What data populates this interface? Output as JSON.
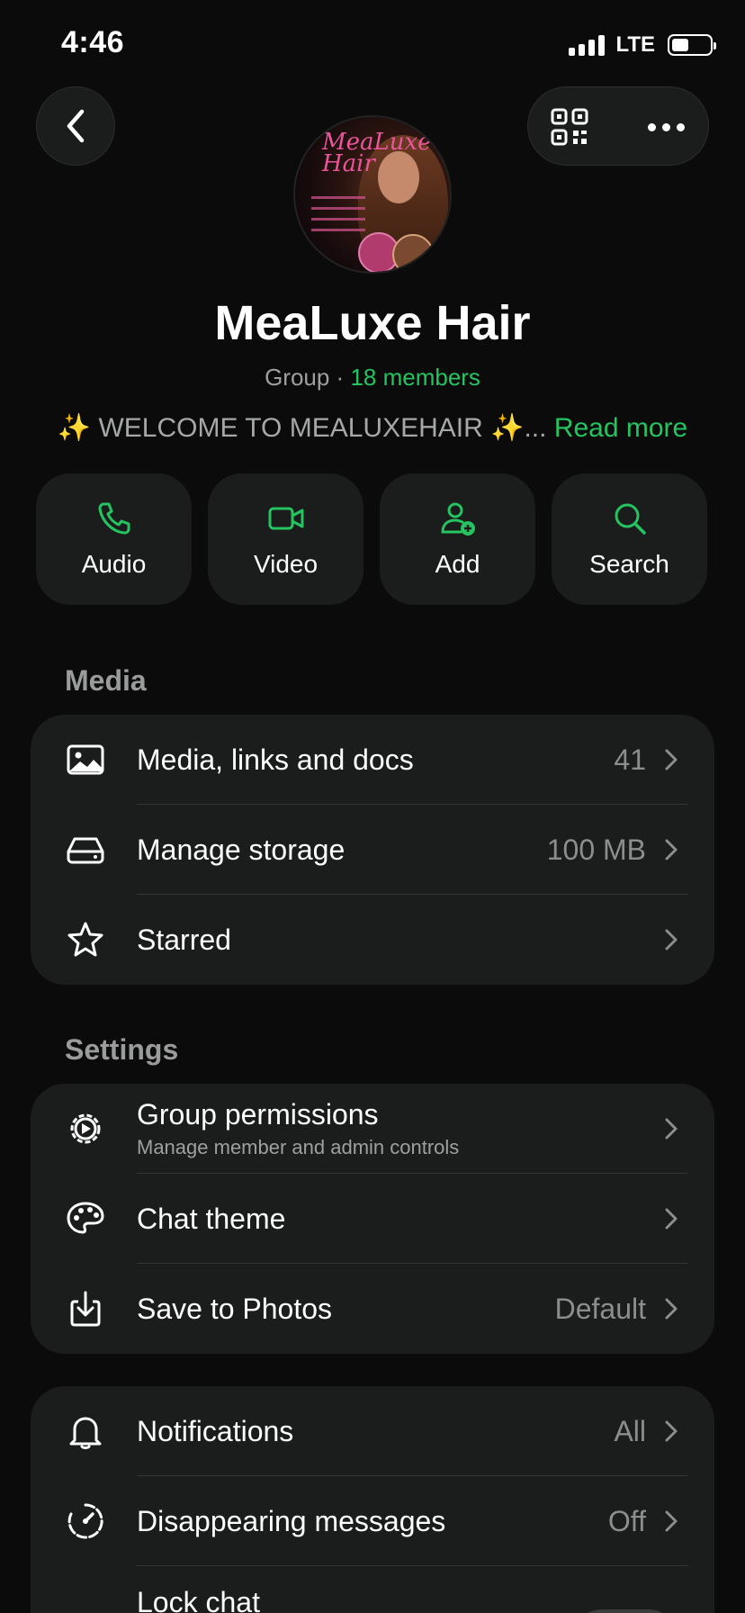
{
  "status_bar": {
    "time": "4:46",
    "network": "LTE"
  },
  "header": {
    "back_icon": "chevron-left-icon",
    "qr_icon": "qr-code-icon",
    "more_icon": "more-horizontal-icon"
  },
  "profile": {
    "name": "MeaLuxe Hair",
    "type_label": "Group · ",
    "members": "18 members",
    "description": "✨ WELCOME TO MEALUXEHAIR ✨...",
    "read_more": "Read more",
    "avatar_brand": "MeaLuxe Hair"
  },
  "actions": [
    {
      "label": "Audio",
      "icon": "phone-icon"
    },
    {
      "label": "Video",
      "icon": "video-icon"
    },
    {
      "label": "Add",
      "icon": "add-user-icon"
    },
    {
      "label": "Search",
      "icon": "search-icon"
    }
  ],
  "media_section": {
    "title": "Media",
    "items": [
      {
        "label": "Media, links and docs",
        "value": "41",
        "icon": "image-icon"
      },
      {
        "label": "Manage storage",
        "value": "100 MB",
        "icon": "storage-icon"
      },
      {
        "label": "Starred",
        "value": "",
        "icon": "star-icon"
      }
    ]
  },
  "settings_section": {
    "title": "Settings",
    "items": [
      {
        "label": "Group permissions",
        "sublabel": "Manage member and admin controls",
        "value": "",
        "icon": "gear-icon"
      },
      {
        "label": "Chat theme",
        "value": "",
        "icon": "palette-icon"
      },
      {
        "label": "Save to Photos",
        "value": "Default",
        "icon": "download-icon"
      }
    ]
  },
  "notify_section": {
    "items": [
      {
        "label": "Notifications",
        "value": "All",
        "icon": "bell-icon"
      },
      {
        "label": "Disappearing messages",
        "value": "Off",
        "icon": "timer-icon"
      },
      {
        "label": "Lock chat",
        "value": "",
        "icon": "lock-icon",
        "toggle_on": false
      }
    ]
  },
  "colors": {
    "accent": "#25c461",
    "card": "#1b1c1c",
    "background": "#0b0b0b"
  }
}
